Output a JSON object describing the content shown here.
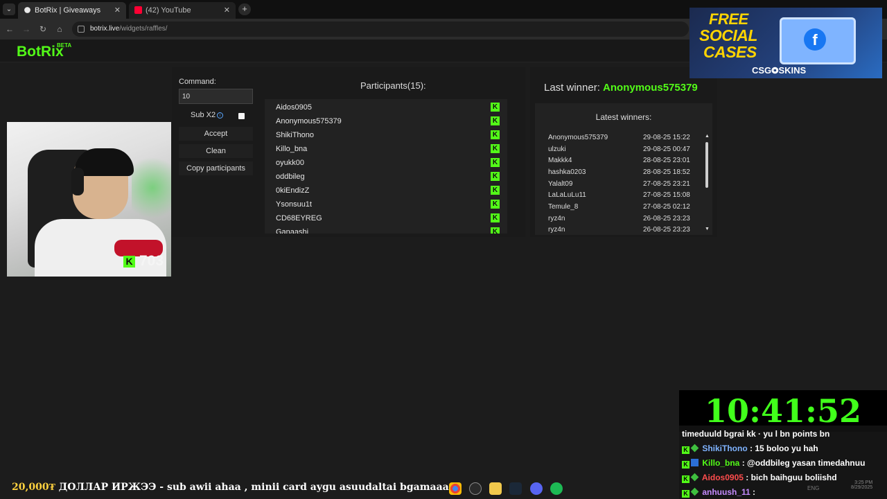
{
  "browser": {
    "tabs": [
      {
        "label": "BotRix | Giveaways",
        "active": true,
        "icon_color": "#e8e8e8"
      },
      {
        "label": "(42) YouTube",
        "active": false,
        "icon_color": "#ff0033"
      }
    ],
    "url_domain": "botrix.live",
    "url_path": "/widgets/raffles/"
  },
  "site": {
    "logo": "BotRix",
    "logo_badge": "BETA",
    "accent_color": "#53fc18"
  },
  "raffle": {
    "command_label": "Command:",
    "command_value": "10",
    "sub_x2_label": "Sub X2",
    "accept_label": "Accept",
    "clean_label": "Clean",
    "copy_label": "Copy participants",
    "participants_title": "Participants(15):",
    "participants": [
      "Aidos0905",
      "Anonymous575379",
      "ShikiThono",
      "Killo_bna",
      "oyukk00",
      "oddbileg",
      "0kiEndizZ",
      "Ysonsuu1t",
      "CD68EYREG",
      "Ganaashi"
    ]
  },
  "winners": {
    "last_winner_label": "Last winner:",
    "last_winner_name": "Anonymous575379",
    "latest_title": "Latest winners:",
    "list": [
      {
        "name": "Anonymous575379",
        "date": "29-08-25 15:22"
      },
      {
        "name": "ulzuki",
        "date": "29-08-25 00:47"
      },
      {
        "name": "Makkk4",
        "date": "28-08-25 23:01"
      },
      {
        "name": "hashka0203",
        "date": "28-08-25 18:52"
      },
      {
        "name": "Yalalt09",
        "date": "27-08-25 23:21"
      },
      {
        "name": "LaLaLuLu11",
        "date": "27-08-25 15:08"
      },
      {
        "name": "Temule_8",
        "date": "27-08-25 02:12"
      },
      {
        "name": "ryz4n",
        "date": "26-08-25 23:23"
      },
      {
        "name": "ryz4n",
        "date": "26-08-25 23:23"
      }
    ]
  },
  "webcam": {
    "points_value": "703"
  },
  "ad": {
    "line1": "FREE",
    "line2": "SOCIAL",
    "line3": "CASES",
    "brand": "CSG⭗SKINS"
  },
  "stream": {
    "timer": "10:41:52",
    "chat": [
      {
        "user": "",
        "user_color": "#ffffff",
        "text": "timeduuld bgrai kk · yu l bn points bn"
      },
      {
        "user": "ShikiThono",
        "user_color": "#7fb3ff",
        "text": ": 15 boloo yu hah"
      },
      {
        "user": "Killo_bna",
        "user_color": "#53fc18",
        "text": ": @oddbileg yasan timedahnuu"
      },
      {
        "user": "Aidos0905",
        "user_color": "#ff4d4d",
        "text": ": bich baihguu boliishd"
      },
      {
        "user": "anhuush_11",
        "user_color": "#c58bff",
        "text": ":"
      }
    ],
    "ticker_amount": "20,000₮",
    "ticker_text": "ДОЛЛАР ИРЖЭЭ - sub awii ahaa , minii card aygu asuudaltai bgamaaa"
  },
  "taskbar": {
    "lang": "ENG",
    "time": "3:25 PM",
    "date": "8/29/2025"
  }
}
